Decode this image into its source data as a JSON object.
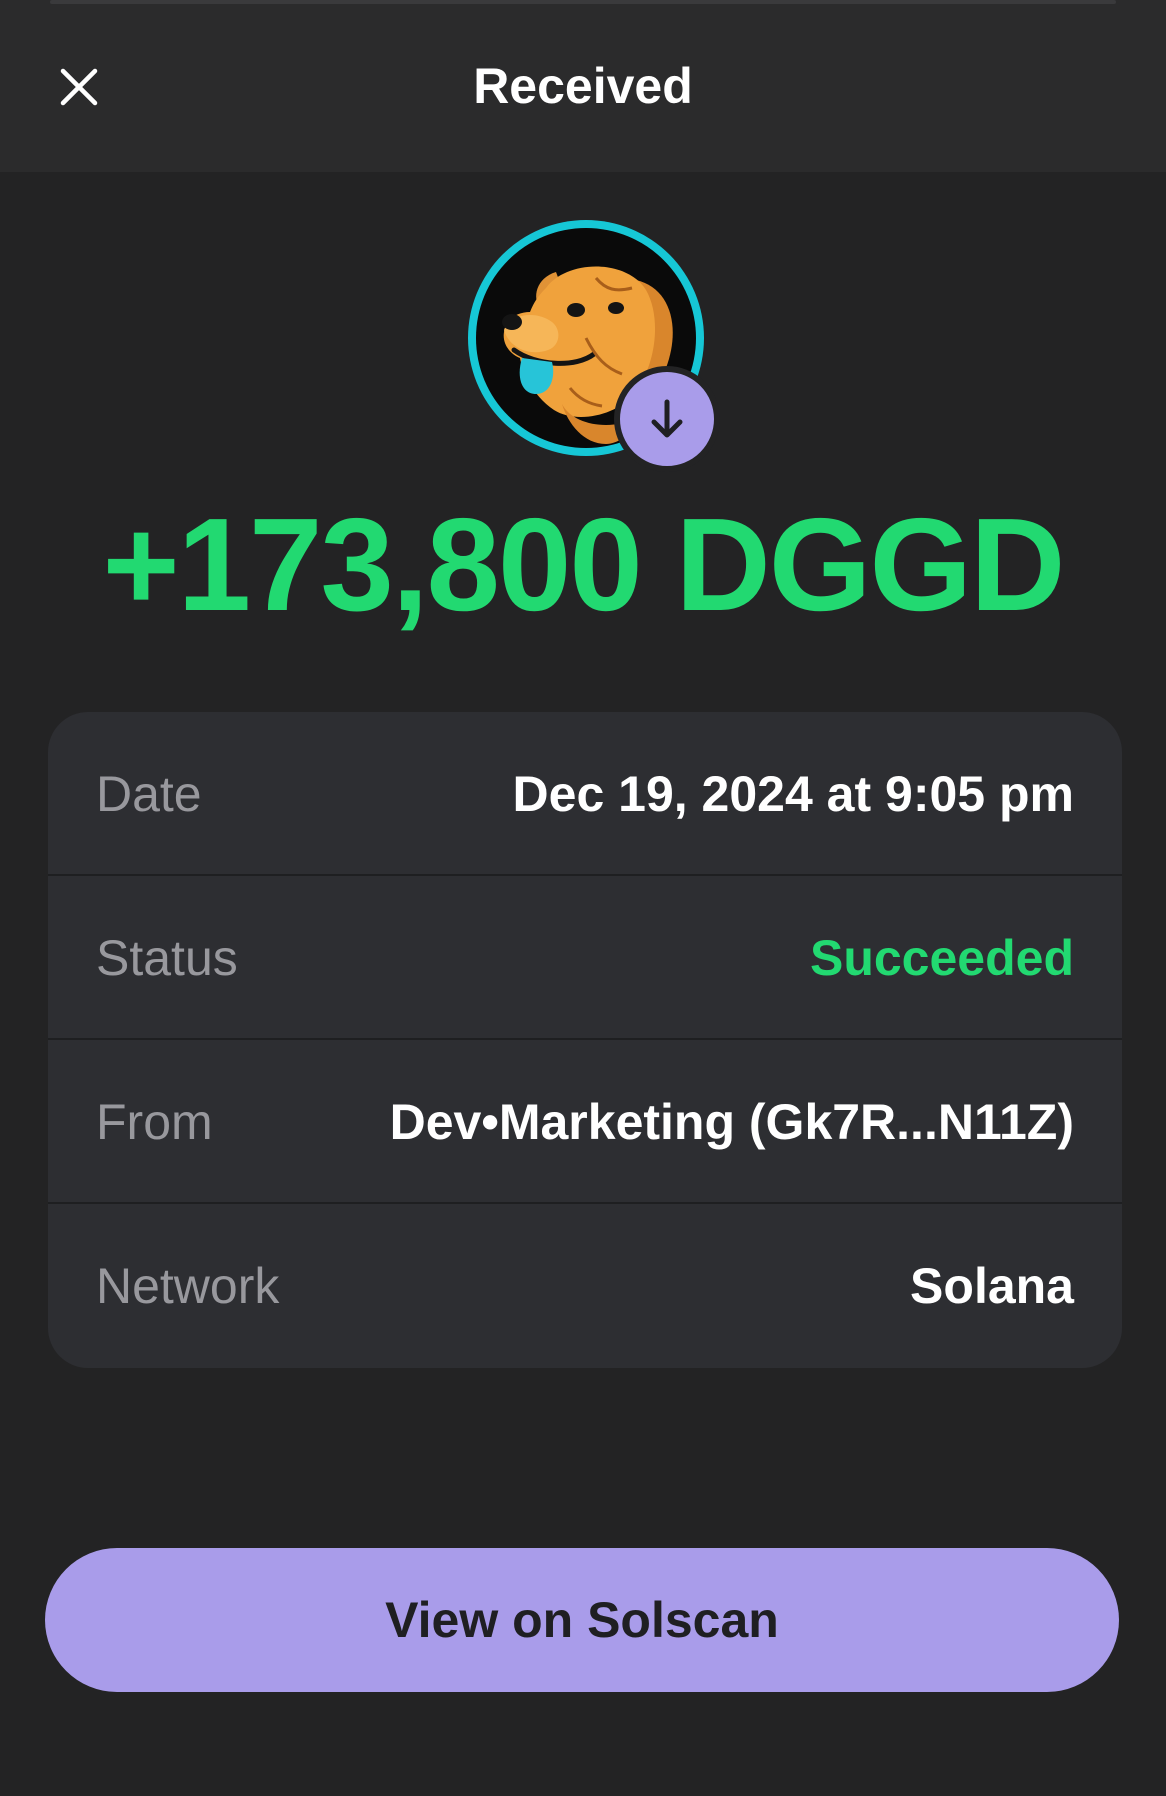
{
  "header": {
    "title": "Received",
    "close_icon": "close-icon"
  },
  "token": {
    "avatar_icon": "dog-token-logo",
    "badge_icon": "arrow-down-icon",
    "badge_color": "#a99cea"
  },
  "amount": "+173,800 DGGD",
  "amount_color": "#22d971",
  "details": {
    "date": {
      "label": "Date",
      "value": "Dec 19, 2024 at 9:05 pm"
    },
    "status": {
      "label": "Status",
      "value": "Succeeded"
    },
    "from": {
      "label": "From",
      "value": "Dev•Marketing (Gk7R...N11Z)"
    },
    "network": {
      "label": "Network",
      "value": "Solana"
    }
  },
  "actions": {
    "view_solscan": "View on Solscan"
  }
}
